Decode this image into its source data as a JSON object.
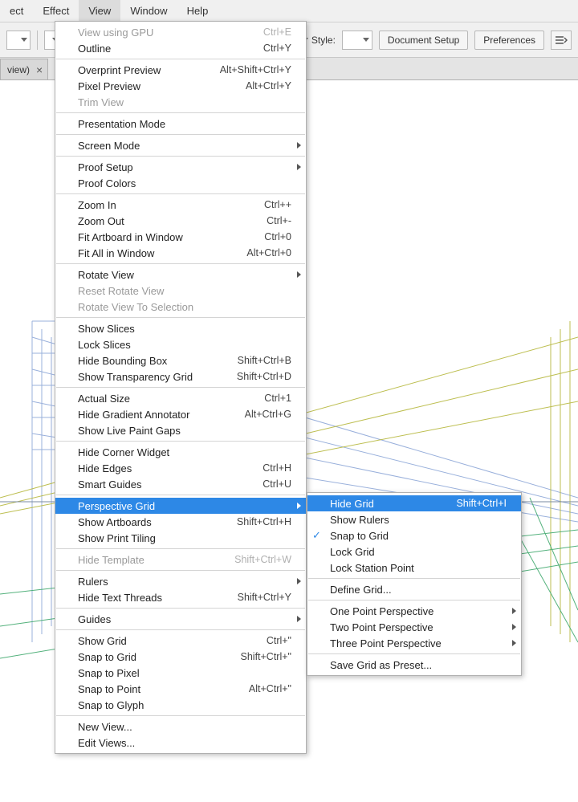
{
  "menubar": {
    "items": [
      "ect",
      "Effect",
      "View",
      "Window",
      "Help"
    ],
    "open_index": 2
  },
  "toolbar": {
    "style_label": "Style:",
    "doc_setup_label": "Document Setup",
    "prefs_label": "Preferences"
  },
  "tab": {
    "label": "view)",
    "close": "×"
  },
  "view_menu": [
    {
      "label": "View using GPU",
      "shortcut": "Ctrl+E",
      "disabled": true
    },
    {
      "label": "Outline",
      "shortcut": "Ctrl+Y"
    },
    {
      "sep": true
    },
    {
      "label": "Overprint Preview",
      "shortcut": "Alt+Shift+Ctrl+Y"
    },
    {
      "label": "Pixel Preview",
      "shortcut": "Alt+Ctrl+Y"
    },
    {
      "label": "Trim View",
      "disabled": true
    },
    {
      "sep": true
    },
    {
      "label": "Presentation Mode"
    },
    {
      "sep": true
    },
    {
      "label": "Screen Mode",
      "sub": true
    },
    {
      "sep": true
    },
    {
      "label": "Proof Setup",
      "sub": true
    },
    {
      "label": "Proof Colors"
    },
    {
      "sep": true
    },
    {
      "label": "Zoom In",
      "shortcut": "Ctrl++"
    },
    {
      "label": "Zoom Out",
      "shortcut": "Ctrl+-"
    },
    {
      "label": "Fit Artboard in Window",
      "shortcut": "Ctrl+0"
    },
    {
      "label": "Fit All in Window",
      "shortcut": "Alt+Ctrl+0"
    },
    {
      "sep": true
    },
    {
      "label": "Rotate View",
      "sub": true
    },
    {
      "label": "Reset Rotate View",
      "disabled": true
    },
    {
      "label": "Rotate View To Selection",
      "disabled": true
    },
    {
      "sep": true
    },
    {
      "label": "Show Slices"
    },
    {
      "label": "Lock Slices"
    },
    {
      "label": "Hide Bounding Box",
      "shortcut": "Shift+Ctrl+B"
    },
    {
      "label": "Show Transparency Grid",
      "shortcut": "Shift+Ctrl+D"
    },
    {
      "sep": true
    },
    {
      "label": "Actual Size",
      "shortcut": "Ctrl+1"
    },
    {
      "label": "Hide Gradient Annotator",
      "shortcut": "Alt+Ctrl+G"
    },
    {
      "label": "Show Live Paint Gaps"
    },
    {
      "sep": true
    },
    {
      "label": "Hide Corner Widget"
    },
    {
      "label": "Hide Edges",
      "shortcut": "Ctrl+H"
    },
    {
      "label": "Smart Guides",
      "shortcut": "Ctrl+U"
    },
    {
      "sep": true
    },
    {
      "label": "Perspective Grid",
      "sub": true,
      "highlight": true
    },
    {
      "label": "Show Artboards",
      "shortcut": "Shift+Ctrl+H"
    },
    {
      "label": "Show Print Tiling"
    },
    {
      "sep": true
    },
    {
      "label": "Hide Template",
      "shortcut": "Shift+Ctrl+W",
      "disabled": true
    },
    {
      "sep": true
    },
    {
      "label": "Rulers",
      "sub": true
    },
    {
      "label": "Hide Text Threads",
      "shortcut": "Shift+Ctrl+Y"
    },
    {
      "sep": true
    },
    {
      "label": "Guides",
      "sub": true
    },
    {
      "sep": true
    },
    {
      "label": "Show Grid",
      "shortcut": "Ctrl+\""
    },
    {
      "label": "Snap to Grid",
      "shortcut": "Shift+Ctrl+\""
    },
    {
      "label": "Snap to Pixel"
    },
    {
      "label": "Snap to Point",
      "shortcut": "Alt+Ctrl+\""
    },
    {
      "label": "Snap to Glyph"
    },
    {
      "sep": true
    },
    {
      "label": "New View..."
    },
    {
      "label": "Edit Views..."
    }
  ],
  "sub_menu": [
    {
      "label": "Hide Grid",
      "shortcut": "Shift+Ctrl+I",
      "highlight": true
    },
    {
      "label": "Show Rulers"
    },
    {
      "label": "Snap to Grid",
      "checked": true
    },
    {
      "label": "Lock Grid"
    },
    {
      "label": "Lock Station Point"
    },
    {
      "sep": true
    },
    {
      "label": "Define Grid..."
    },
    {
      "sep": true
    },
    {
      "label": "One Point Perspective",
      "sub": true
    },
    {
      "label": "Two Point Perspective",
      "sub": true
    },
    {
      "label": "Three Point Perspective",
      "sub": true
    },
    {
      "sep": true
    },
    {
      "label": "Save Grid as Preset..."
    }
  ]
}
